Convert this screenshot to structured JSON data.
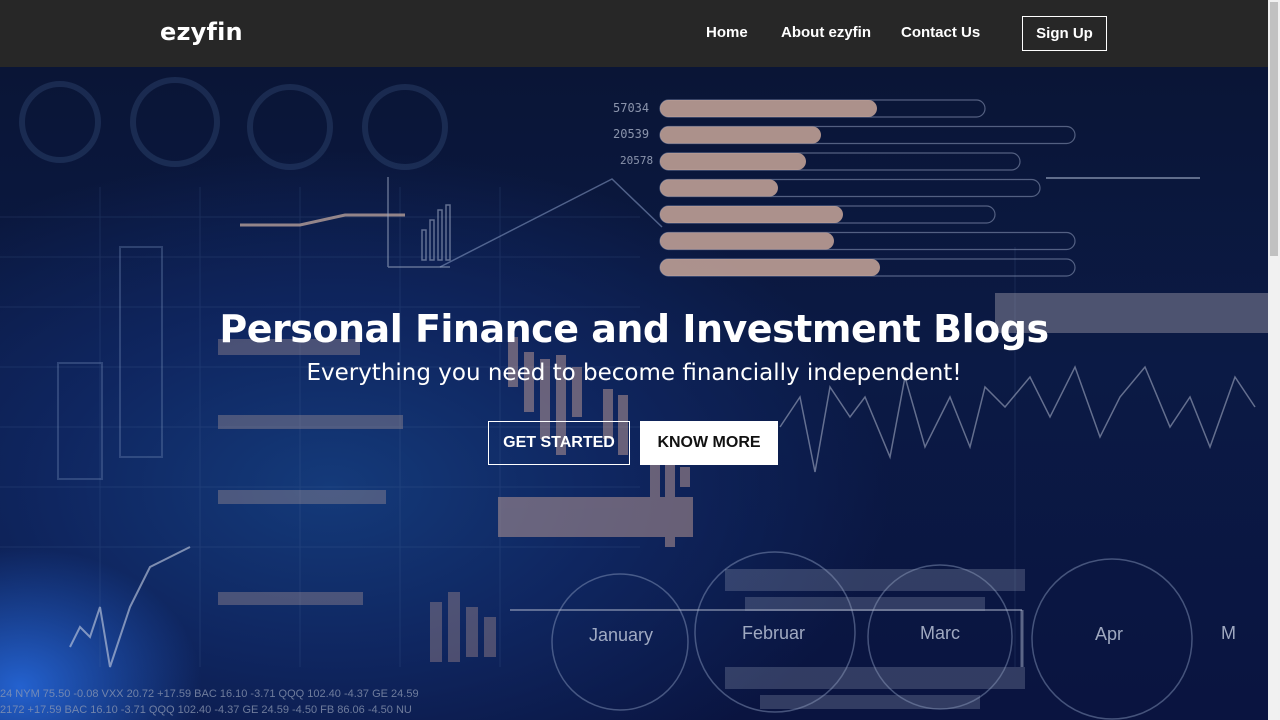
{
  "nav": {
    "brand": "ezyfin",
    "links": [
      "Home",
      "About ezyfin",
      "Contact Us"
    ],
    "signup": "Sign Up"
  },
  "hero": {
    "title": "Personal Finance and Investment Blogs",
    "subtitle": "Everything you need to become financially independent!",
    "primary_button": "GET STARTED",
    "secondary_button": "KNOW MORE"
  },
  "background": {
    "numbers": [
      "57034",
      "20539",
      "20578"
    ],
    "months": [
      "January",
      "Februar",
      "Marc",
      "Apr",
      "M"
    ],
    "ticker_line_1": "24 NYM 75.50 -0.08 VXX 20.72 +17.59 BAC 16.10 -3.71 QQQ 102.40 -4.37 GE 24.59",
    "ticker_line_2": "2172 +17.59 BAC 16.10 -3.71 QQQ 102.40 -4.37 GE 24.59 -4.50 FB 86.06 -4.50 NU",
    "bars_fraction": [
      0.7,
      0.52,
      0.47,
      0.38,
      0.59,
      0.56,
      0.71
    ],
    "colors": {
      "navbar": "#272727",
      "hero_base": "#0a1536",
      "bar_fill": "#c9a79a",
      "text": "#ffffff"
    }
  },
  "icons": {
    "scrollbar": "scrollbar-thumb"
  }
}
